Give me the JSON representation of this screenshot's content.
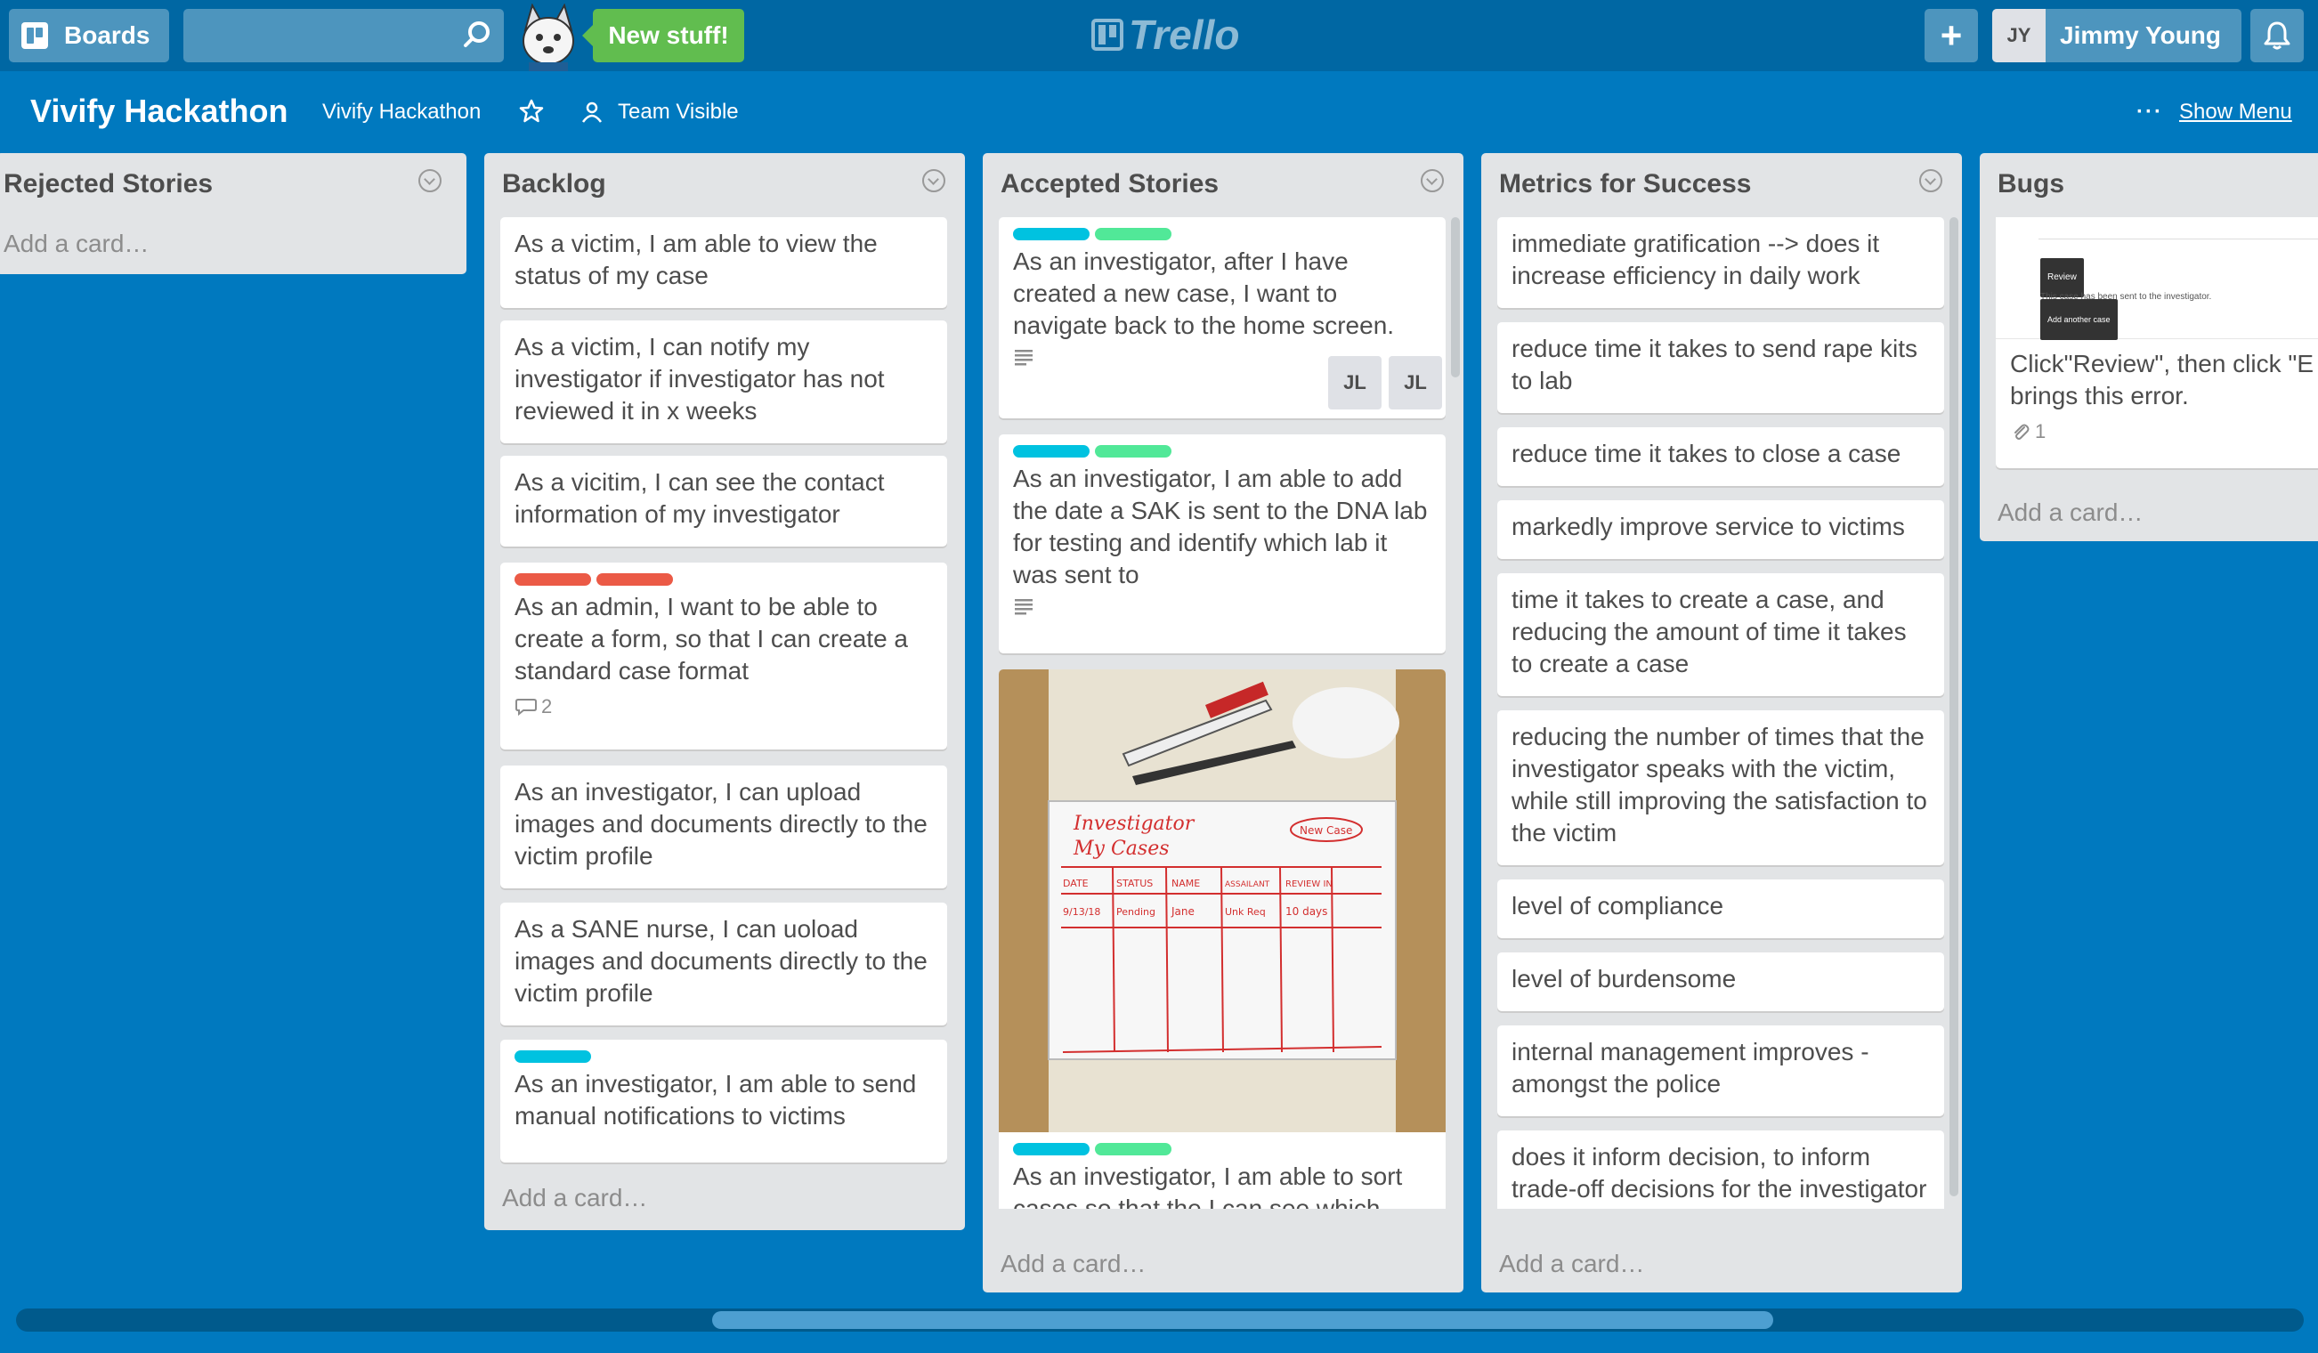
{
  "header": {
    "boards_label": "Boards",
    "search_placeholder": "",
    "new_stuff_label": "New stuff!",
    "logo_text": "Trello",
    "add_label": "+",
    "user_initials": "JY",
    "user_name": "Jimmy Young",
    "icons": {
      "boards": "boards-icon",
      "search": "search-icon",
      "add": "plus-icon",
      "notifications": "bell-icon"
    }
  },
  "board": {
    "title": "Vivify Hackathon",
    "team": "Vivify Hackathon",
    "visibility": "Team Visible",
    "show_menu": "Show Menu",
    "menu_dots": "···"
  },
  "lists": [
    {
      "name": "Rejected Stories",
      "add": "Add a card…",
      "cards": []
    },
    {
      "name": "Backlog",
      "add": "Add a card…",
      "cards": [
        {
          "text": "As a victim, I am able to view the status of my case"
        },
        {
          "text": "As a victim, I can notify my investigator if investigator has not reviewed it in x weeks"
        },
        {
          "text": "As a vicitim, I can see the contact information of my investigator"
        },
        {
          "text": "As an admin, I want to be able to create a form, so that I can create a standard case format",
          "comments": "2"
        },
        {
          "text": "As an investigator, I can upload images and documents directly to the victim profile"
        },
        {
          "text": "As a SANE nurse, I can uoload images and documents directly to the victim profile"
        },
        {
          "text": "As an investigator, I am able to send manual notifications to victims"
        }
      ]
    },
    {
      "name": "Accepted Stories",
      "add": "Add a card…",
      "cards": [
        {
          "text": "As an investigator, after I have created a new case, I want to navigate back to the home screen.",
          "members": [
            "JL",
            "JL"
          ]
        },
        {
          "text": "As an investigator, I am able to add the date a SAK is sent to the DNA lab for testing and identify which lab it was sent to"
        },
        {
          "text": "As an investigator, I am able to sort cases so that the I can see which",
          "whiteboard": {
            "title_lines": [
              "Investigator",
              "My Cases"
            ],
            "new_case": "New Case",
            "columns": [
              "DATE",
              "STATUS",
              "NAME",
              "ASSAILANT",
              "REVIEW IN"
            ],
            "row": [
              "9/13/18",
              "Pending",
              "Jane",
              "Unk Req",
              "10 days"
            ]
          }
        }
      ]
    },
    {
      "name": "Metrics for Success",
      "add": "Add a card…",
      "cards": [
        {
          "text": "immediate gratification --> does it increase efficiency in daily work"
        },
        {
          "text": "reduce time it takes to send rape kits to lab"
        },
        {
          "text": "reduce time it takes to close a case"
        },
        {
          "text": "markedly improve service to victims"
        },
        {
          "text": "time it takes to create a case, and reducing the amount of time it takes to create a case"
        },
        {
          "text": "reducing the number of times that the investigator speaks with the victim, while still improving the satisfaction to the victim"
        },
        {
          "text": "level of compliance"
        },
        {
          "text": "level of burdensome"
        },
        {
          "text": "internal management improves - amongst the police"
        },
        {
          "text": "does it inform decision, to inform trade-off decisions for the investigator"
        }
      ]
    },
    {
      "name": "Bugs",
      "add": "Add a card…",
      "cards": [
        {
          "text_line1": "Click\"Review\", then click \"E",
          "text_line2": "brings this error.",
          "attachments": "1",
          "thumb_button": "Review",
          "thumb_text": "This case has been sent to the investigator.",
          "thumb_button2": "Add another case"
        }
      ]
    }
  ],
  "colors": {
    "board_bg": "#0079bf",
    "header_bg": "#0067a3",
    "label_blue": "#00c2e0",
    "label_green": "#51e898",
    "label_red": "#eb5a46"
  }
}
